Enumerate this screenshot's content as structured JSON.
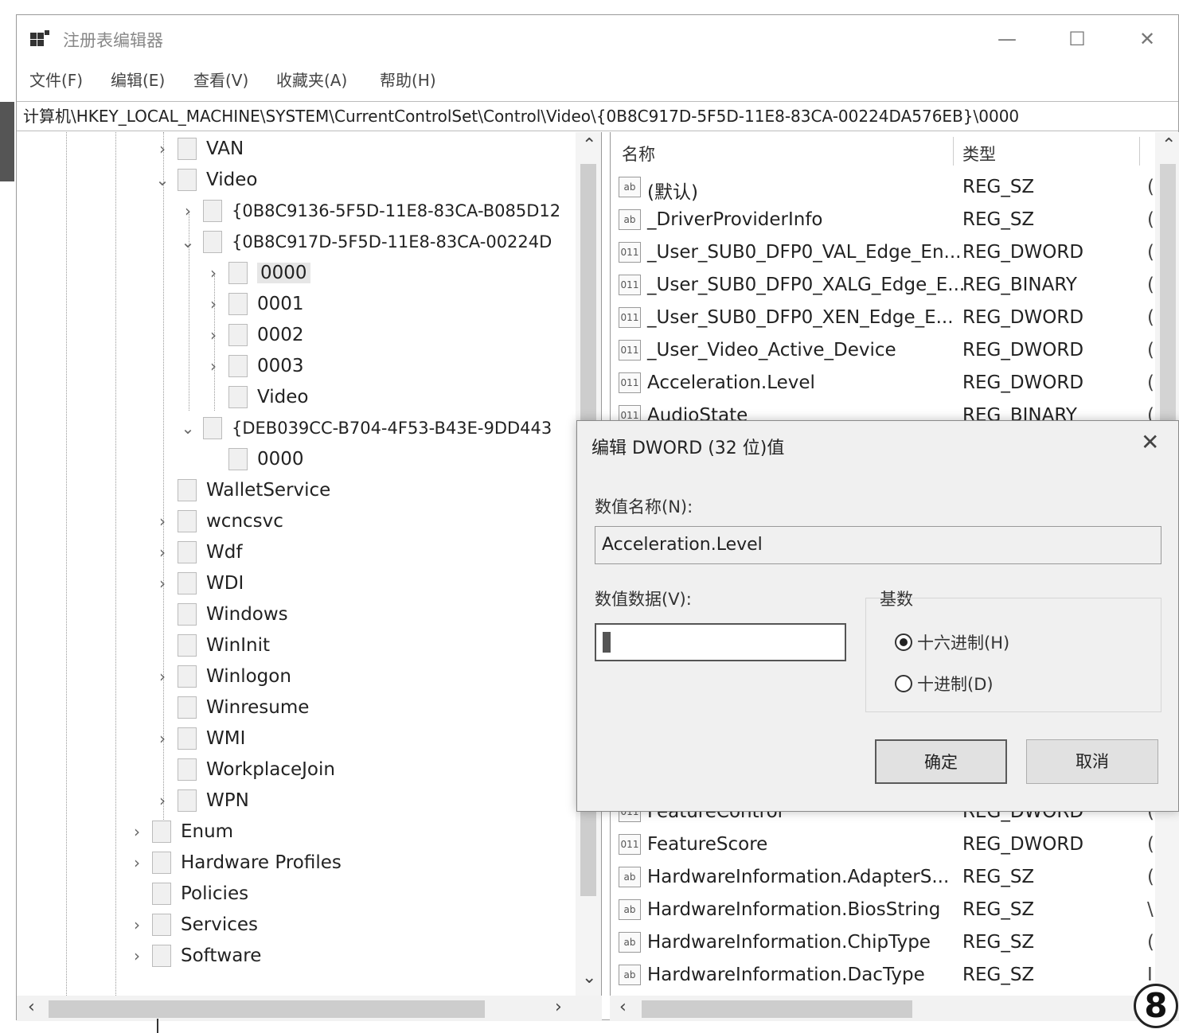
{
  "window": {
    "title": "注册表编辑器",
    "minimize": "—",
    "maximize": "☐",
    "close": "✕"
  },
  "menu": [
    "文件(F)",
    "编辑(E)",
    "查看(V)",
    "收藏夹(A)",
    "帮助(H)"
  ],
  "address": "计算机\\HKEY_LOCAL_MACHINE\\SYSTEM\\CurrentControlSet\\Control\\Video\\{0B8C917D-5F5D-11E8-83CA-00224DA576EB}\\0000",
  "tree": [
    {
      "label": "VAN",
      "exp": "›"
    },
    {
      "label": "Video",
      "exp": "⌄"
    },
    {
      "label": "{0B8C9136-5F5D-11E8-83CA-B085D12",
      "exp": "›"
    },
    {
      "label": "{0B8C917D-5F5D-11E8-83CA-00224D",
      "exp": "⌄"
    },
    {
      "label": "0000",
      "exp": "›"
    },
    {
      "label": "0001",
      "exp": "›"
    },
    {
      "label": "0002",
      "exp": "›"
    },
    {
      "label": "0003",
      "exp": "›"
    },
    {
      "label": "Video",
      "exp": ""
    },
    {
      "label": "{DEB039CC-B704-4F53-B43E-9DD443",
      "exp": "⌄"
    },
    {
      "label": "0000",
      "exp": ""
    },
    {
      "label": "WalletService",
      "exp": ""
    },
    {
      "label": "wcncsvc",
      "exp": "›"
    },
    {
      "label": "Wdf",
      "exp": "›"
    },
    {
      "label": "WDI",
      "exp": "›"
    },
    {
      "label": "Windows",
      "exp": ""
    },
    {
      "label": "WinInit",
      "exp": ""
    },
    {
      "label": "Winlogon",
      "exp": "›"
    },
    {
      "label": "Winresume",
      "exp": ""
    },
    {
      "label": "WMI",
      "exp": "›"
    },
    {
      "label": "WorkplaceJoin",
      "exp": ""
    },
    {
      "label": "WPN",
      "exp": "›"
    },
    {
      "label": "Enum",
      "exp": "›"
    },
    {
      "label": "Hardware Profiles",
      "exp": "›"
    },
    {
      "label": "Policies",
      "exp": ""
    },
    {
      "label": "Services",
      "exp": "›"
    },
    {
      "label": "Software",
      "exp": "›"
    }
  ],
  "list": {
    "col_name": "名称",
    "col_type": "类型",
    "rows": [
      {
        "icon": "ab",
        "name": "(默认)",
        "type": "REG_SZ",
        "data": "("
      },
      {
        "icon": "ab",
        "name": "_DriverProviderInfo",
        "type": "REG_SZ",
        "data": "("
      },
      {
        "icon": "011",
        "name": "_User_SUB0_DFP0_VAL_Edge_En...",
        "type": "REG_DWORD",
        "data": "("
      },
      {
        "icon": "011",
        "name": "_User_SUB0_DFP0_XALG_Edge_E...",
        "type": "REG_BINARY",
        "data": "("
      },
      {
        "icon": "011",
        "name": "_User_SUB0_DFP0_XEN_Edge_E...",
        "type": "REG_DWORD",
        "data": "("
      },
      {
        "icon": "011",
        "name": "_User_Video_Active_Device",
        "type": "REG_DWORD",
        "data": "("
      },
      {
        "icon": "011",
        "name": "Acceleration.Level",
        "type": "REG_DWORD",
        "data": "("
      },
      {
        "icon": "011",
        "name": "AudioState",
        "type": "REG_BINARY",
        "data": "("
      },
      {
        "icon": "011",
        "name": "FeatureControl",
        "type": "REG_DWORD",
        "data": "("
      },
      {
        "icon": "011",
        "name": "FeatureScore",
        "type": "REG_DWORD",
        "data": "("
      },
      {
        "icon": "ab",
        "name": "HardwareInformation.AdapterS...",
        "type": "REG_SZ",
        "data": "("
      },
      {
        "icon": "ab",
        "name": "HardwareInformation.BiosString",
        "type": "REG_SZ",
        "data": "\\"
      },
      {
        "icon": "ab",
        "name": "HardwareInformation.ChipType",
        "type": "REG_SZ",
        "data": "("
      },
      {
        "icon": "ab",
        "name": "HardwareInformation.DacType",
        "type": "REG_SZ",
        "data": "I"
      }
    ]
  },
  "dialog": {
    "title": "编辑 DWORD (32 位)值",
    "close": "✕",
    "name_label": "数值名称(N):",
    "name_value": "Acceleration.Level",
    "data_label": "数值数据(V):",
    "data_value": "",
    "base_label": "基数",
    "hex_label": "十六进制(H)",
    "dec_label": "十进制(D)",
    "ok": "确定",
    "cancel": "取消"
  },
  "badge": "8"
}
